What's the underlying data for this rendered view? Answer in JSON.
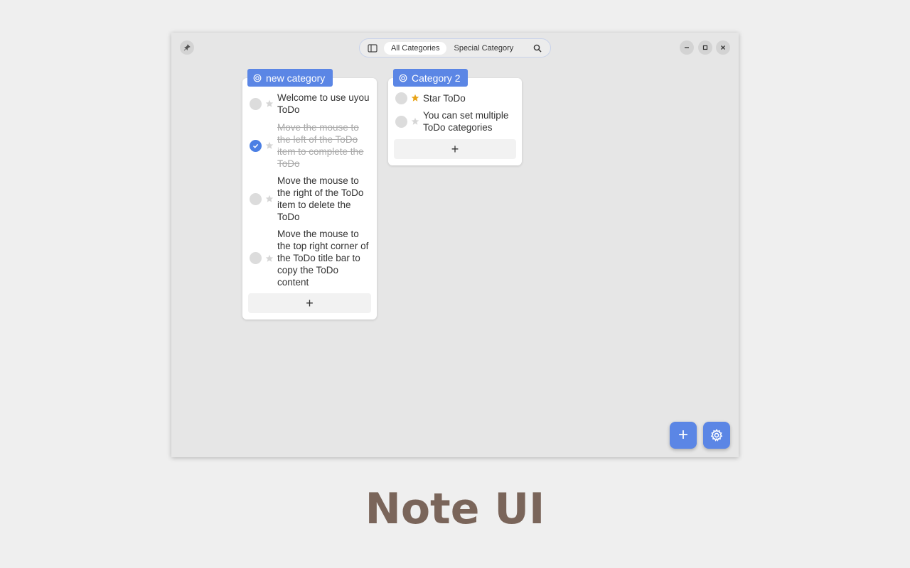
{
  "toolbar": {
    "tabs": [
      {
        "label": "All Categories",
        "active": true
      },
      {
        "label": "Special Category",
        "active": false
      }
    ],
    "icons": [
      "sidebar-icon",
      "search-icon"
    ]
  },
  "window_controls": [
    "pin-icon",
    "minimize-icon",
    "maximize-icon",
    "close-icon"
  ],
  "categories": [
    {
      "name": "new category",
      "items": [
        {
          "text": "Welcome to use uyou ToDo",
          "done": false,
          "starred": false
        },
        {
          "text": "Move the mouse to the left of the ToDo item to complete the ToDo",
          "done": true,
          "starred": false
        },
        {
          "text": "Move the mouse to the right of the ToDo item to delete the ToDo",
          "done": false,
          "starred": false
        },
        {
          "text": "Move the mouse to the top right corner of the ToDo title bar to copy the ToDo content",
          "done": false,
          "starred": false
        }
      ],
      "add_label": "+"
    },
    {
      "name": "Category 2",
      "items": [
        {
          "text": "Star ToDo",
          "done": false,
          "starred": true
        },
        {
          "text": "You can set multiple ToDo categories",
          "done": false,
          "starred": false
        }
      ],
      "add_label": "+"
    }
  ],
  "fab": {
    "add_label": "+",
    "settings_icon": "gear-icon"
  },
  "caption": "Note UI",
  "colors": {
    "accent": "#5b86e5",
    "star_active": "#e8a317",
    "caption": "#7a655a"
  }
}
